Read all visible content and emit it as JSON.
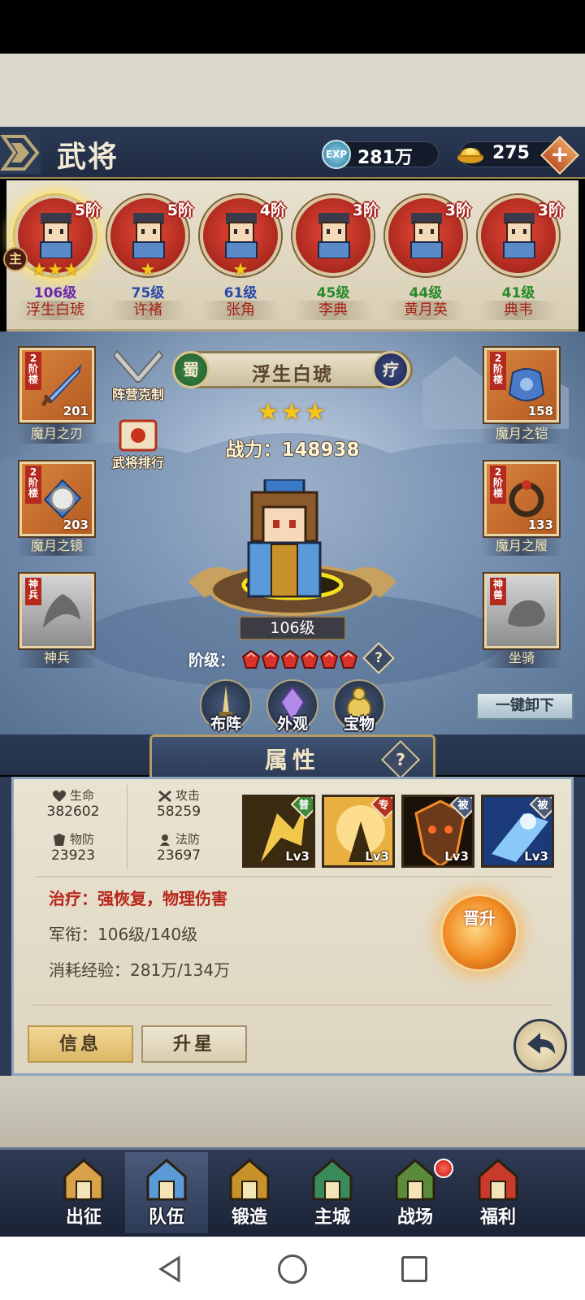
{
  "header": {
    "title": "武将",
    "exp_icon": "EXP",
    "exp_value": "281万",
    "gold_value": "275",
    "plus": "+"
  },
  "roster": {
    "master_badge": "主",
    "heroes": [
      {
        "name": "浮生白琥",
        "rank": "5阶",
        "stars": "★★★",
        "level": "106级",
        "level_color": "#6a2aa8",
        "selected": true
      },
      {
        "name": "许褚",
        "rank": "5阶",
        "stars": "★",
        "level": "75级",
        "level_color": "#2a4aa8"
      },
      {
        "name": "张角",
        "rank": "4阶",
        "stars": "★",
        "level": "61级",
        "level_color": "#2a4aa8"
      },
      {
        "name": "李典",
        "rank": "3阶",
        "stars": "",
        "level": "45级",
        "level_color": "#2a8a2a"
      },
      {
        "name": "黄月英",
        "rank": "3阶",
        "stars": "",
        "level": "44级",
        "level_color": "#2a8a2a"
      },
      {
        "name": "典韦",
        "rank": "3阶",
        "stars": "",
        "level": "41级",
        "level_color": "#2a8a2a"
      }
    ]
  },
  "hero": {
    "faction": "蜀",
    "name": "浮生白琥",
    "class": "疗",
    "stars": "★★★",
    "power": "战力：148938",
    "level_plate": "106级",
    "rank_label": "阶级：",
    "rank_help": "?",
    "gems": 6
  },
  "side_buttons": {
    "arena": "阵营克制",
    "ranking": "武将排行"
  },
  "equipment": {
    "weapon": {
      "tag": "2阶楼",
      "count": "201",
      "label": "魔月之刃"
    },
    "mirror": {
      "tag": "2阶楼",
      "count": "203",
      "label": "魔月之镜"
    },
    "divine_weapon": {
      "tag": "神兵",
      "label": "神兵"
    },
    "armor": {
      "tag": "2阶楼",
      "count": "158",
      "label": "魔月之铠"
    },
    "boots": {
      "tag": "2阶楼",
      "count": "133",
      "label": "魔月之履"
    },
    "mount": {
      "tag": "神兽",
      "label": "坐骑"
    }
  },
  "action_buttons": {
    "formation": "布阵",
    "appearance": "外观",
    "treasure": "宝物",
    "unequip_all": "一键卸下"
  },
  "attributes": {
    "title": "属性",
    "help": "?",
    "hp_label": "生命",
    "hp_value": "382602",
    "atk_label": "攻击",
    "atk_value": "58259",
    "pdef_label": "物防",
    "pdef_value": "23923",
    "mdef_label": "法防",
    "mdef_value": "23697",
    "skills": [
      {
        "tag": "普",
        "tag_color": "#3f8a3a",
        "level": "Lv3",
        "icon": "strike-skill-icon"
      },
      {
        "tag": "专",
        "tag_color": "#b5321e",
        "level": "Lv3",
        "icon": "meditate-skill-icon"
      },
      {
        "tag": "被",
        "tag_color": "#4a5a7a",
        "level": "Lv3",
        "icon": "demon-mask-skill-icon"
      },
      {
        "tag": "被",
        "tag_color": "#4a5a7a",
        "level": "Lv3",
        "icon": "blue-warrior-skill-icon"
      }
    ],
    "description": "治疗：强恢复，物理伤害",
    "rank_line": "军衔：106级/140级",
    "exp_line": "消耗经验：281万/134万",
    "promote": "晋升"
  },
  "tabs": {
    "info": "信息",
    "star_up": "升星"
  },
  "nav": [
    {
      "label": "出征",
      "icon": "crossed-swords-icon"
    },
    {
      "label": "队伍",
      "icon": "team-helmet-icon",
      "active": true
    },
    {
      "label": "锻造",
      "icon": "forge-hammer-icon"
    },
    {
      "label": "主城",
      "icon": "castle-icon"
    },
    {
      "label": "战场",
      "icon": "battlefield-icon",
      "badge": true
    },
    {
      "label": "福利",
      "icon": "welfare-palace-icon"
    }
  ],
  "colors": {
    "accent_gold": "#f5c51c",
    "dark_blue": "#2b3a55",
    "red_text": "#b8251a"
  }
}
